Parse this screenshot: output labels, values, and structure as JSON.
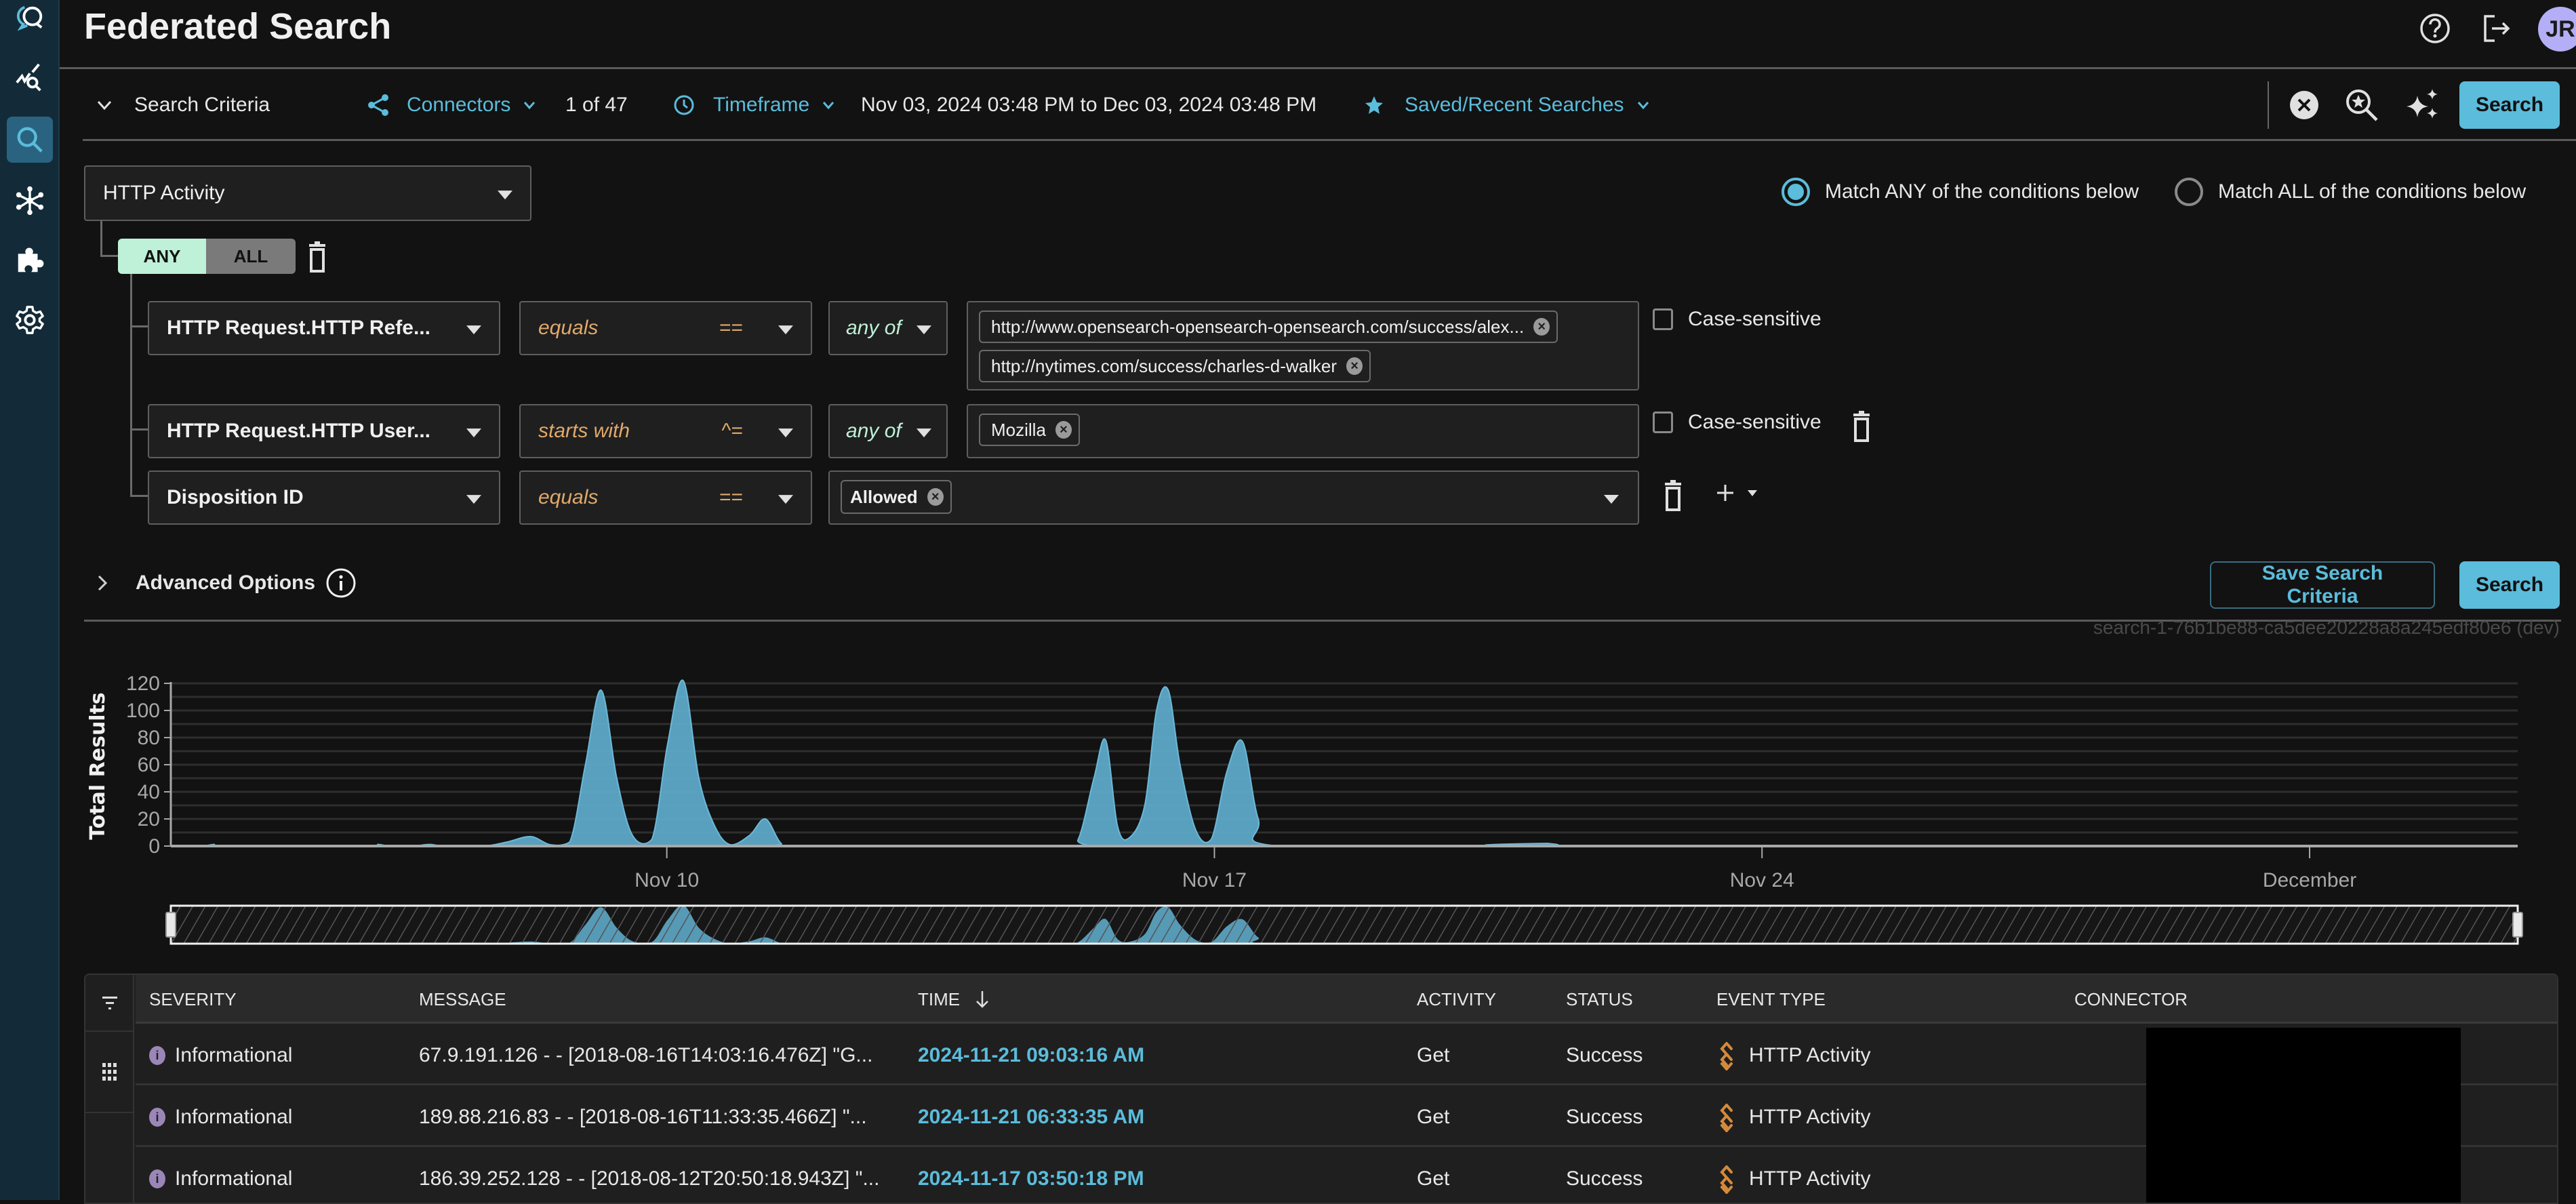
{
  "app": {
    "title": "Federated Search",
    "user_initials": "JR"
  },
  "sidebar": {
    "items": [
      {
        "name": "logo",
        "icon": "chat-search-logo-icon",
        "active": false
      },
      {
        "name": "analytics",
        "icon": "trend-search-icon",
        "active": false
      },
      {
        "name": "search",
        "icon": "search-icon",
        "active": true
      },
      {
        "name": "connectors",
        "icon": "network-hub-icon",
        "active": false
      },
      {
        "name": "integrations",
        "icon": "puzzle-piece-icon",
        "active": false
      },
      {
        "name": "settings",
        "icon": "gear-icon",
        "active": false
      }
    ]
  },
  "header_actions": {
    "help_icon": "question-circle-icon",
    "logout_icon": "logout-icon"
  },
  "criteria_bar": {
    "toggle_label": "Search Criteria",
    "connectors_label": "Connectors",
    "connectors_count": "1 of 47",
    "timeframe_label": "Timeframe",
    "timeframe_value": "Nov 03, 2024 03:48 PM to Dec 03, 2024 03:48 PM",
    "saved_label": "Saved/Recent Searches",
    "search_label": "Search"
  },
  "query": {
    "event_class": "HTTP Activity",
    "group_toggle": {
      "options": [
        "ANY",
        "ALL"
      ],
      "selected": "ANY"
    },
    "match_options": [
      {
        "label": "Match ANY of the conditions below",
        "selected": true
      },
      {
        "label": "Match ALL of the conditions below",
        "selected": false
      }
    ],
    "conditions": [
      {
        "field": "HTTP Request.HTTP Refe...",
        "operator": "equals",
        "operator_symbol": "==",
        "quantifier": "any of",
        "values": [
          "http://www.opensearch-opensearch-opensearch.com/success/alex...",
          "http://nytimes.com/success/charles-d-walker"
        ],
        "case_sensitive_label": "Case-sensitive",
        "case_sensitive": false
      },
      {
        "field": "HTTP Request.HTTP User...",
        "operator": "starts with",
        "operator_symbol": "^=",
        "quantifier": "any of",
        "values": [
          "Mozilla"
        ],
        "case_sensitive_label": "Case-sensitive",
        "case_sensitive": false
      },
      {
        "field": "Disposition ID",
        "operator": "equals",
        "operator_symbol": "==",
        "values": [
          "Allowed"
        ]
      }
    ],
    "advanced_options_label": "Advanced Options",
    "save_button": "Save Search Criteria",
    "search_button": "Search",
    "search_id": "search-1-76b1be88-ca5dee20228a8a245edf80e6 (dev)"
  },
  "chart_data": {
    "type": "area",
    "title": "",
    "xlabel": "",
    "ylabel": "Total Results",
    "ylim": [
      0,
      120
    ],
    "yticks": [
      0,
      20,
      40,
      60,
      80,
      100,
      120
    ],
    "xlim_days": [
      0,
      30
    ],
    "x_origin": "Nov 03, 2024 03:48 PM",
    "x_unit": "days since Nov 03, 2024 03:48 PM",
    "xticks": [
      {
        "label": "Nov 10",
        "day": 6.34
      },
      {
        "label": "Nov 17",
        "day": 13.34
      },
      {
        "label": "Nov 24",
        "day": 20.34
      },
      {
        "label": "December",
        "day": 27.34
      }
    ],
    "grid": true,
    "series": [
      {
        "name": "Total Results",
        "color": "#5ea8c8",
        "points": [
          [
            0,
            0
          ],
          [
            0.4,
            0
          ],
          [
            0.55,
            1.2
          ],
          [
            0.7,
            0
          ],
          [
            2.5,
            0
          ],
          [
            2.65,
            1.2
          ],
          [
            2.8,
            0
          ],
          [
            3.1,
            0
          ],
          [
            3.3,
            1.2
          ],
          [
            3.5,
            0
          ],
          [
            4.0,
            0
          ],
          [
            4.3,
            3
          ],
          [
            4.6,
            7
          ],
          [
            4.85,
            1
          ],
          [
            5.1,
            3
          ],
          [
            5.3,
            60
          ],
          [
            5.5,
            115
          ],
          [
            5.7,
            50
          ],
          [
            5.9,
            8
          ],
          [
            6.15,
            5
          ],
          [
            6.35,
            75
          ],
          [
            6.55,
            122
          ],
          [
            6.75,
            50
          ],
          [
            6.95,
            15
          ],
          [
            7.15,
            1
          ],
          [
            7.4,
            8
          ],
          [
            7.6,
            20
          ],
          [
            7.8,
            2
          ],
          [
            8.0,
            0
          ],
          [
            11.4,
            0
          ],
          [
            11.6,
            5
          ],
          [
            11.8,
            50
          ],
          [
            11.95,
            78
          ],
          [
            12.1,
            15
          ],
          [
            12.25,
            6
          ],
          [
            12.45,
            30
          ],
          [
            12.6,
            100
          ],
          [
            12.75,
            115
          ],
          [
            12.9,
            60
          ],
          [
            13.1,
            12
          ],
          [
            13.3,
            5
          ],
          [
            13.5,
            55
          ],
          [
            13.7,
            77
          ],
          [
            13.9,
            20
          ],
          [
            14.15,
            0
          ],
          [
            17.45,
            0
          ],
          [
            17.6,
            2
          ],
          [
            17.75,
            0
          ],
          [
            30,
            0
          ]
        ]
      }
    ],
    "navigator": {
      "range_days": [
        0,
        30
      ],
      "handles": [
        "left",
        "right"
      ]
    }
  },
  "table": {
    "side_icons": [
      "filter-icon",
      "columns-grid-icon"
    ],
    "columns": [
      "SEVERITY",
      "MESSAGE",
      "TIME",
      "ACTIVITY",
      "STATUS",
      "EVENT TYPE",
      "CONNECTOR"
    ],
    "sort_column": "TIME",
    "sort_direction": "desc",
    "rows": [
      {
        "severity": "Informational",
        "message": "67.9.191.126 - - [2018-08-16T14:03:16.476Z] \"G...",
        "time": "2024-11-21 09:03:16 AM",
        "activity": "Get",
        "status": "Success",
        "event_type": "HTTP Activity",
        "connector": ""
      },
      {
        "severity": "Informational",
        "message": "189.88.216.83 - - [2018-08-16T11:33:35.466Z] \"...",
        "time": "2024-11-21 06:33:35 AM",
        "activity": "Get",
        "status": "Success",
        "event_type": "HTTP Activity",
        "connector": ""
      },
      {
        "severity": "Informational",
        "message": "186.39.252.128 - - [2018-08-12T20:50:18.943Z] \"...",
        "time": "2024-11-17 03:50:18 PM",
        "activity": "Get",
        "status": "Success",
        "event_type": "HTTP Activity",
        "connector": ""
      }
    ]
  },
  "colors": {
    "accent": "#5bbcdb",
    "operator": "#e1a96a",
    "quantifier": "#bff0d8",
    "event_type_icon": "#d58a3a",
    "severity_info": "#9b86b8",
    "avatar": "#b3aef5",
    "sidebar_bg": "#132b38"
  }
}
